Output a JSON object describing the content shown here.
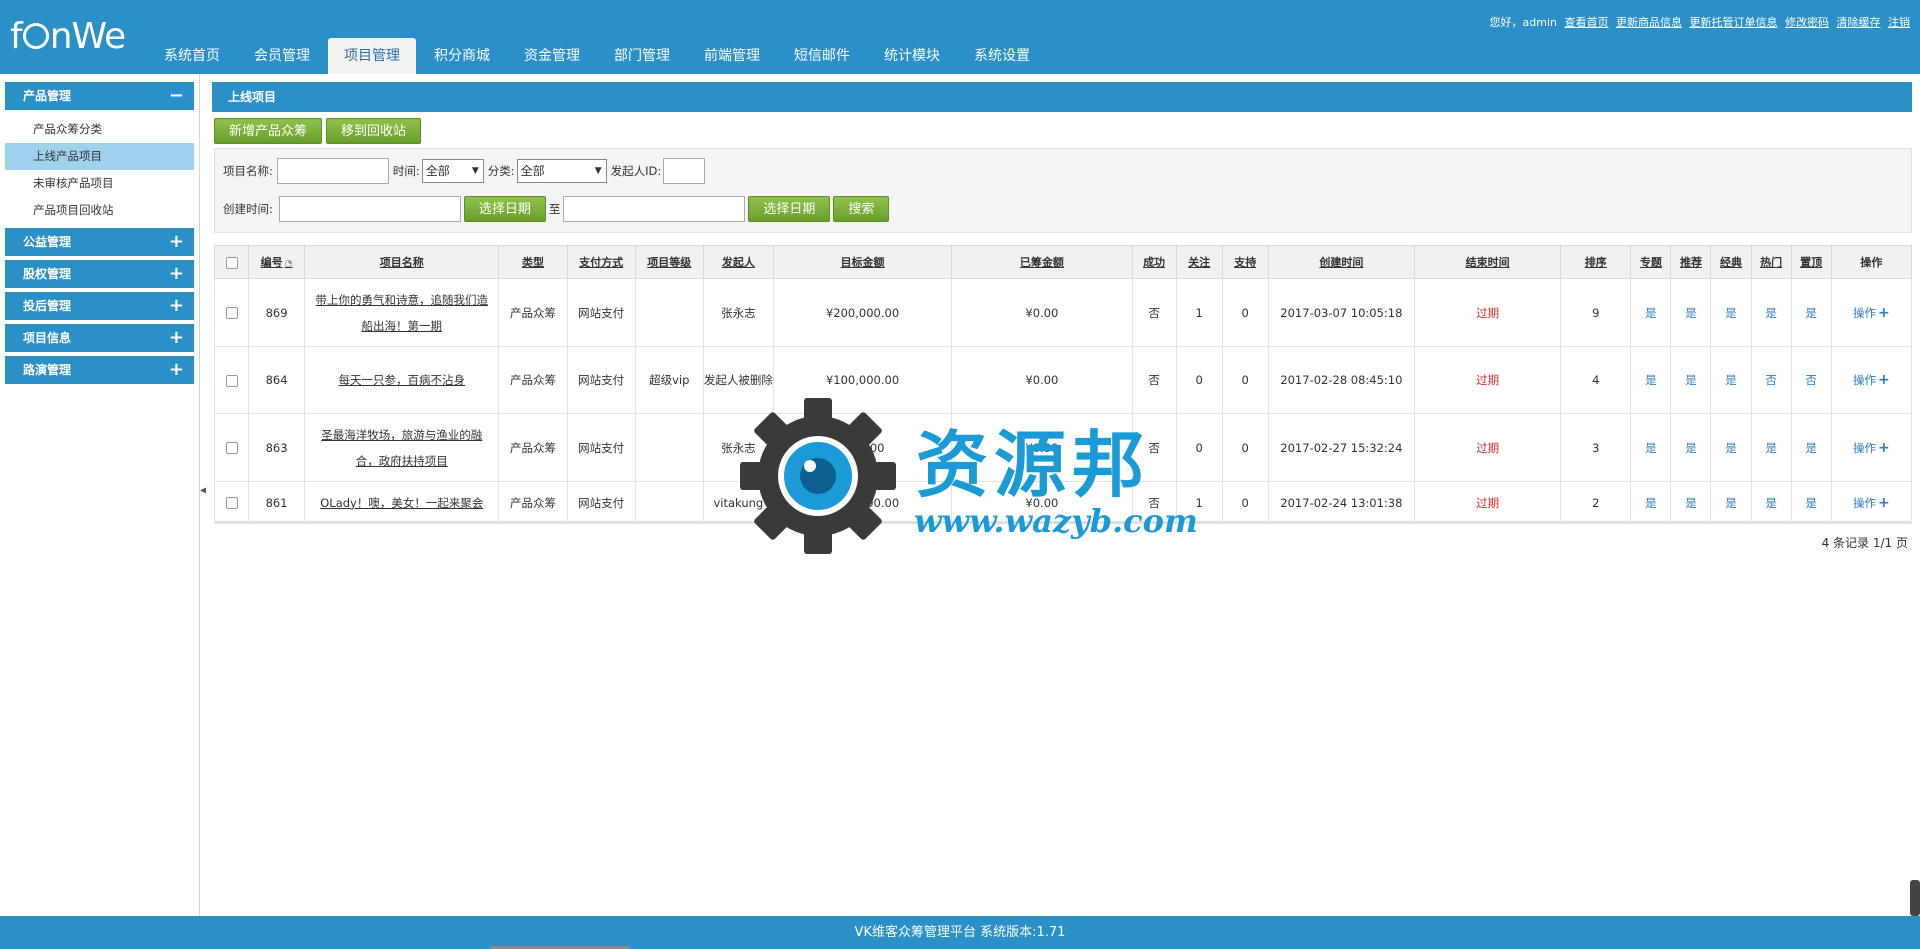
{
  "header": {
    "logo": "fanWe",
    "nav": [
      "系统首页",
      "会员管理",
      "项目管理",
      "积分商城",
      "资金管理",
      "部门管理",
      "前端管理",
      "短信邮件",
      "统计模块",
      "系统设置"
    ],
    "active_nav": "项目管理",
    "greeting": "您好，admin",
    "links": [
      "查看首页",
      "更新商品信息",
      "更新托管订单信息",
      "修改密码",
      "清除缓存",
      "注销"
    ]
  },
  "sidebar": {
    "groups": [
      {
        "title": "产品管理",
        "sign": "−",
        "items": [
          "产品众筹分类",
          "上线产品项目",
          "未审核产品项目",
          "产品项目回收站"
        ]
      },
      {
        "title": "公益管理",
        "sign": "+"
      },
      {
        "title": "股权管理",
        "sign": "+"
      },
      {
        "title": "投后管理",
        "sign": "+"
      },
      {
        "title": "项目信息",
        "sign": "+"
      },
      {
        "title": "路演管理",
        "sign": "+"
      }
    ],
    "active_item": "上线产品项目"
  },
  "main": {
    "title": "上线项目",
    "buttons": {
      "add": "新增产品众筹",
      "recycle": "移到回收站"
    },
    "filter": {
      "name_label": "项目名称:",
      "time_label": "时间:",
      "time_value": "全部",
      "category_label": "分类:",
      "category_value": "全部",
      "sponsor_label": "发起人ID:",
      "created_label": "创建时间:",
      "pick_date": "选择日期",
      "to": "至",
      "search": "搜索"
    },
    "table": {
      "headers": [
        "编号",
        "项目名称",
        "类型",
        "支付方式",
        "项目等级",
        "发起人",
        "目标金额",
        "已筹金额",
        "成功",
        "关注",
        "支持",
        "创建时间",
        "结束时间",
        "排序",
        "专题",
        "推荐",
        "经典",
        "热门",
        "置顶",
        "操作"
      ],
      "rows": [
        {
          "id": "869",
          "name": "带上你的勇气和诗意，追随我们造船出海！第一期",
          "type": "产品众筹",
          "pay": "网站支付",
          "level": "",
          "sponsor": "张永志",
          "target": "¥200,000.00",
          "raised": "¥0.00",
          "success": "否",
          "follow": "1",
          "support": "0",
          "created": "2017-03-07 10:05:18",
          "end": "过期",
          "sort": "9",
          "topic": "是",
          "recommend": "是",
          "classic": "是",
          "hot": "是",
          "top": "是",
          "op": "操作"
        },
        {
          "id": "864",
          "name": "每天一只参，百病不沾身",
          "type": "产品众筹",
          "pay": "网站支付",
          "level": "超级vip",
          "sponsor": "发起人被删除",
          "target": "¥100,000.00",
          "raised": "¥0.00",
          "success": "否",
          "follow": "0",
          "support": "0",
          "created": "2017-02-28 08:45:10",
          "end": "过期",
          "sort": "4",
          "topic": "是",
          "recommend": "是",
          "classic": "是",
          "hot": "否",
          "top": "否",
          "op": "操作"
        },
        {
          "id": "863",
          "name": "圣最海洋牧场，旅游与渔业的融合，政府扶持项目",
          "type": "产品众筹",
          "pay": "网站支付",
          "level": "",
          "sponsor": "张永志",
          "target": "¥...0.00",
          "raised": "¥0.00",
          "success": "否",
          "follow": "0",
          "support": "0",
          "created": "2017-02-27 15:32:24",
          "end": "过期",
          "sort": "3",
          "topic": "是",
          "recommend": "是",
          "classic": "是",
          "hot": "是",
          "top": "是",
          "op": "操作"
        },
        {
          "id": "861",
          "name": "OLady！噢，美女！一起来聚会",
          "type": "产品众筹",
          "pay": "网站支付",
          "level": "",
          "sponsor": "vitakung",
          "target": "¥600,000.00",
          "raised": "¥0.00",
          "success": "否",
          "follow": "1",
          "support": "0",
          "created": "2017-02-24 13:01:38",
          "end": "过期",
          "sort": "2",
          "topic": "是",
          "recommend": "是",
          "classic": "是",
          "hot": "是",
          "top": "是",
          "op": "操作"
        }
      ]
    },
    "pager": "4 条记录 1/1 页"
  },
  "footer": "VK维客众筹管理平台 系统版本:1.71",
  "watermark": {
    "text": "资源邦",
    "url": "www.wazyb.com"
  },
  "colors": {
    "primary": "#2b8fc8",
    "green": "#7ab03a",
    "expired": "#d0302e",
    "link": "#2b7fc0"
  }
}
